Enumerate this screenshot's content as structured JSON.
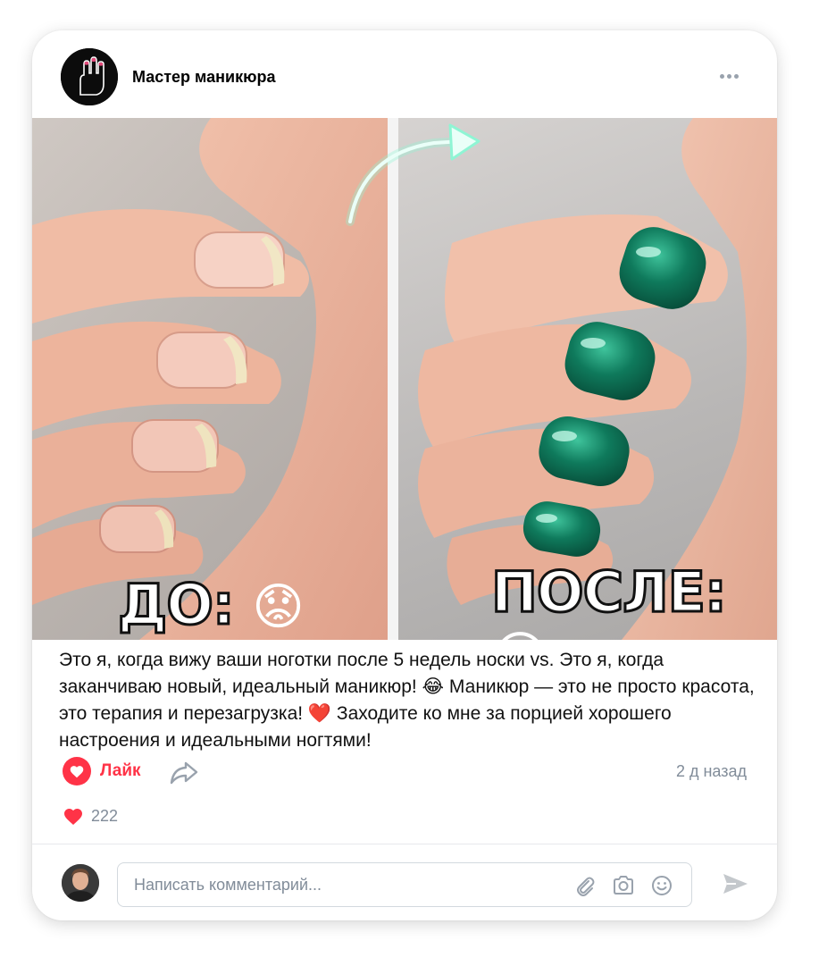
{
  "post": {
    "author": "Мастер маникюра",
    "image": {
      "before_label": "ДО:",
      "after_label": "ПОСЛЕ:",
      "before_emoji": "😟",
      "after_emoji": "😍"
    },
    "text": "Это я, когда вижу ваши ноготки после 5 недель носки vs. Это я, когда заканчиваю новый, идеальный маникюр! 😂 Маникюр — это не просто красота, это терапия и перезагрузка! ❤️ Заходите ко мне за порцией хорошего настроения и идеальными ногтями!",
    "like_label": "Лайк",
    "time_ago": "2 д назад",
    "likes_count": "222"
  },
  "comment": {
    "placeholder": "Написать комментарий..."
  },
  "icons": {
    "more": "more-horizontal-icon",
    "like": "heart-icon",
    "share": "share-icon",
    "attach": "paperclip-icon",
    "camera": "camera-icon",
    "emoji": "smile-icon",
    "send": "send-icon"
  },
  "colors": {
    "like_red": "#ff3347",
    "meta_gray": "#818c99",
    "nail_green": "#0f7a5c",
    "arrow_glow": "#8ff5d4"
  }
}
